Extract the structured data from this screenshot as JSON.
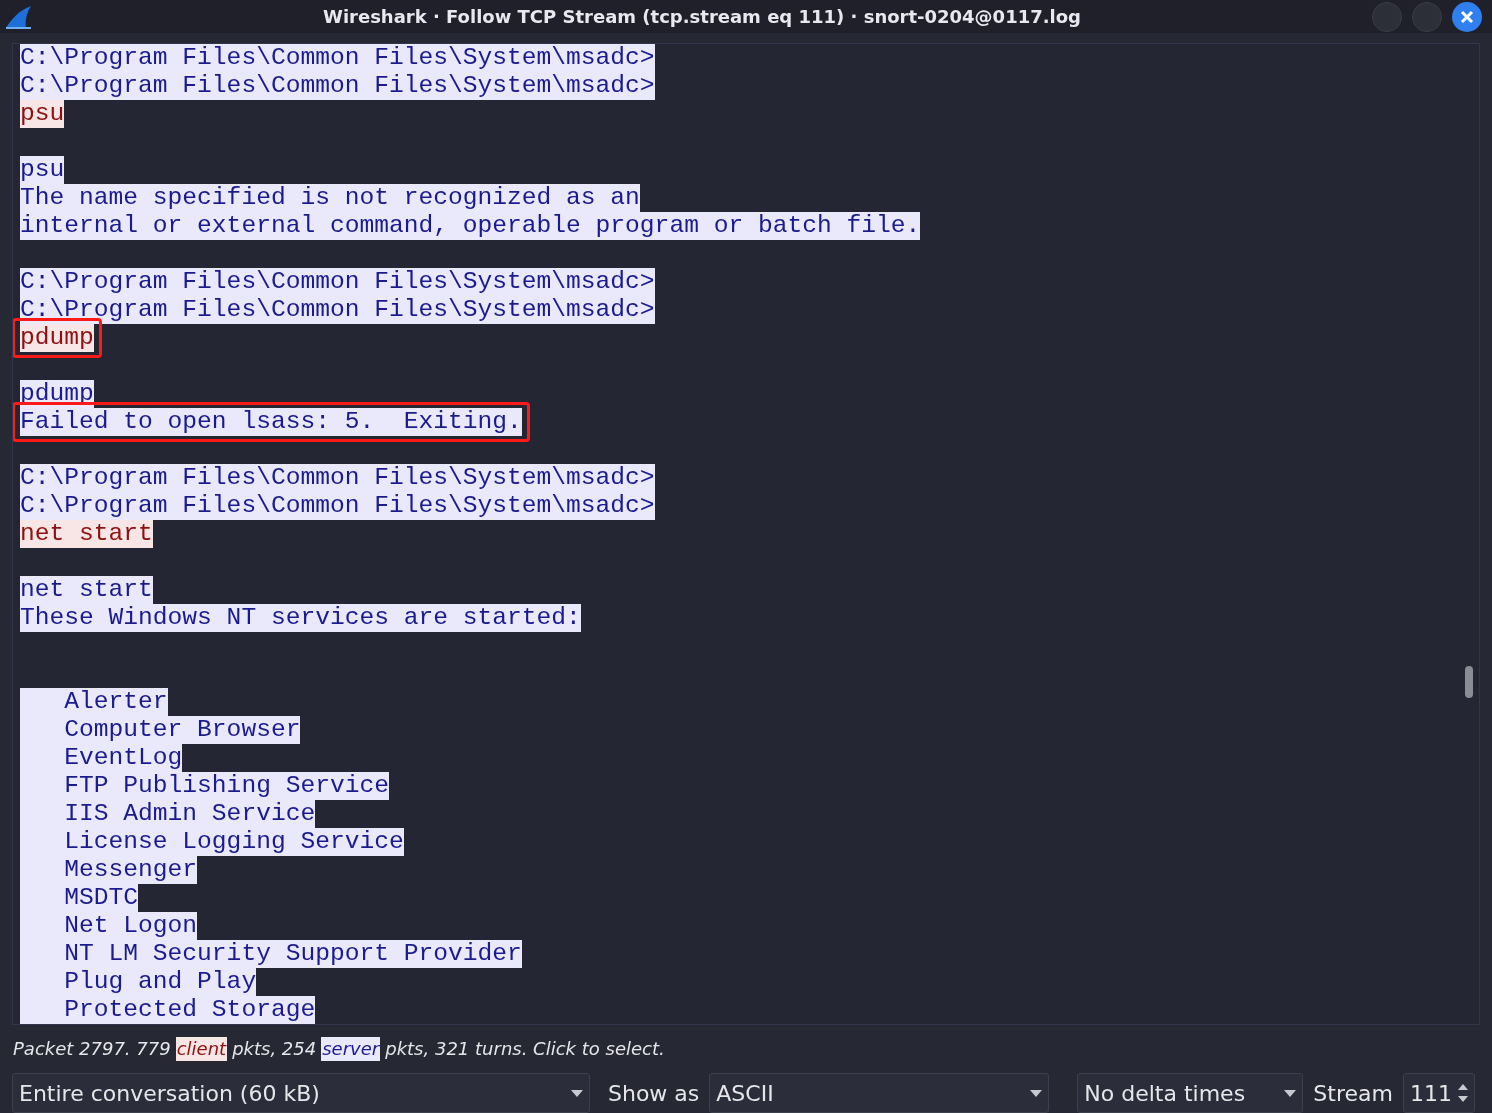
{
  "window": {
    "title": "Wireshark · Follow TCP Stream (tcp.stream eq 111) · snort-0204@0117.log"
  },
  "stream": {
    "lines": [
      {
        "kind": "server",
        "text": "C:\\Program Files\\Common Files\\System\\msadc>",
        "boxed": false
      },
      {
        "kind": "server",
        "text": "C:\\Program Files\\Common Files\\System\\msadc>",
        "boxed": false
      },
      {
        "kind": "client",
        "text": "psu",
        "boxed": false
      },
      {
        "kind": "blank"
      },
      {
        "kind": "server",
        "text": "psu",
        "boxed": false
      },
      {
        "kind": "server",
        "text": "The name specified is not recognized as an",
        "boxed": false
      },
      {
        "kind": "server",
        "text": "internal or external command, operable program or batch file.",
        "boxed": false
      },
      {
        "kind": "blank"
      },
      {
        "kind": "server",
        "text": "C:\\Program Files\\Common Files\\System\\msadc>",
        "boxed": false
      },
      {
        "kind": "server",
        "text": "C:\\Program Files\\Common Files\\System\\msadc>",
        "boxed": false
      },
      {
        "kind": "client",
        "text": "pdump",
        "boxed": true
      },
      {
        "kind": "blank"
      },
      {
        "kind": "server",
        "text": "pdump",
        "boxed": false
      },
      {
        "kind": "server",
        "text": "Failed to open lsass: 5.  Exiting.",
        "boxed": true
      },
      {
        "kind": "blank"
      },
      {
        "kind": "server",
        "text": "C:\\Program Files\\Common Files\\System\\msadc>",
        "boxed": false
      },
      {
        "kind": "server",
        "text": "C:\\Program Files\\Common Files\\System\\msadc>",
        "boxed": false
      },
      {
        "kind": "client",
        "text": "net start",
        "boxed": false
      },
      {
        "kind": "blank"
      },
      {
        "kind": "server",
        "text": "net start",
        "boxed": false
      },
      {
        "kind": "server",
        "text": "These Windows NT services are started:",
        "boxed": false
      },
      {
        "kind": "blank"
      },
      {
        "kind": "blank"
      },
      {
        "kind": "server",
        "text": "   Alerter",
        "boxed": false
      },
      {
        "kind": "server",
        "text": "   Computer Browser",
        "boxed": false
      },
      {
        "kind": "server",
        "text": "   EventLog",
        "boxed": false
      },
      {
        "kind": "server",
        "text": "   FTP Publishing Service",
        "boxed": false
      },
      {
        "kind": "server",
        "text": "   IIS Admin Service",
        "boxed": false
      },
      {
        "kind": "server",
        "text": "   License Logging Service",
        "boxed": false
      },
      {
        "kind": "server",
        "text": "   Messenger",
        "boxed": false
      },
      {
        "kind": "server",
        "text": "   MSDTC",
        "boxed": false
      },
      {
        "kind": "server",
        "text": "   Net Logon",
        "boxed": false
      },
      {
        "kind": "server",
        "text": "   NT LM Security Support Provider",
        "boxed": false
      },
      {
        "kind": "server",
        "text": "   Plug and Play",
        "boxed": false
      },
      {
        "kind": "server",
        "text": "   Protected Storage",
        "boxed": false
      }
    ]
  },
  "status_bar": {
    "segments": [
      {
        "kind": "plain",
        "text": "Packet 2797. 779"
      },
      {
        "kind": "client",
        "text": "client"
      },
      {
        "kind": "plain",
        "text": "pkts, 254"
      },
      {
        "kind": "server",
        "text": "server"
      },
      {
        "kind": "plain",
        "text": "pkts, 321 turns. Click to select."
      }
    ]
  },
  "controls": {
    "conversation": "Entire conversation (60 kB)",
    "show_as_label": "Show as",
    "show_as": "ASCII",
    "delta": "No delta times",
    "stream_label": "Stream",
    "stream": "111"
  }
}
